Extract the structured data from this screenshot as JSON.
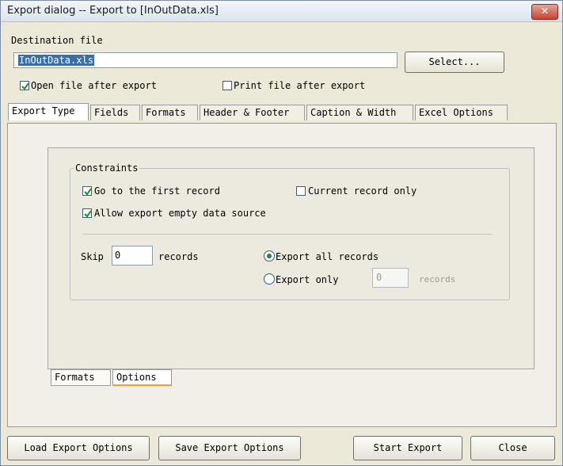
{
  "window": {
    "title": "Export dialog -- Export to [InOutData.xls]",
    "close_glyph": "✕"
  },
  "destination": {
    "label": "Destination file",
    "value": "InOutData.xls",
    "select_button": "Select..."
  },
  "options": {
    "open_after_export": {
      "label": "Open file after export",
      "checked": true
    },
    "print_after_export": {
      "label": "Print file after export",
      "checked": false
    }
  },
  "tabs": [
    {
      "label": "Export Type",
      "active": true
    },
    {
      "label": "Fields",
      "active": false
    },
    {
      "label": "Formats",
      "active": false
    },
    {
      "label": "Header & Footer",
      "active": false
    },
    {
      "label": "Caption & Width",
      "active": false
    },
    {
      "label": "Excel Options",
      "active": false
    }
  ],
  "constraints": {
    "legend": "Constraints",
    "go_first": {
      "label": "Go to the first record",
      "checked": true
    },
    "current_only": {
      "label": "Current record only",
      "checked": false
    },
    "allow_empty": {
      "label": "Allow export empty data source",
      "checked": true
    },
    "skip_label": "Skip",
    "skip_value": "0",
    "records_label": "records",
    "export_all": {
      "label": "Export all records",
      "selected": true
    },
    "export_only": {
      "label": "Export only",
      "selected": false,
      "value": "0",
      "records_label": "records"
    }
  },
  "subtabs": [
    {
      "label": "Formats",
      "active": false
    },
    {
      "label": "Options",
      "active": true
    }
  ],
  "footer": {
    "load": "Load Export Options",
    "save": "Save Export Options",
    "start": "Start Export",
    "close": "Close"
  }
}
